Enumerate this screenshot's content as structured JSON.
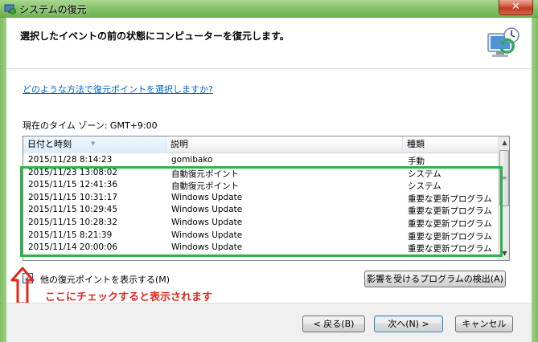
{
  "window": {
    "title": "システムの復元",
    "close_label": "✕"
  },
  "header": {
    "title": "選択したイベントの前の状態にコンピューターを復元します。"
  },
  "help_link": "どのような方法で復元ポイントを選択しますか?",
  "timezone": "現在のタイム ゾーン: GMT+9:00",
  "list": {
    "columns": [
      "日付と時刻",
      "説明",
      "種類"
    ],
    "rows": [
      {
        "date": "2015/11/28 8:14:23",
        "desc": "gomibako",
        "type": "手動"
      },
      {
        "date": "2015/11/23 13:08:02",
        "desc": "自動復元ポイント",
        "type": "システム"
      },
      {
        "date": "2015/11/15 12:41:36",
        "desc": "自動復元ポイント",
        "type": "システム"
      },
      {
        "date": "2015/11/15 10:31:17",
        "desc": "Windows Update",
        "type": "重要な更新プログラム"
      },
      {
        "date": "2015/11/15 10:29:45",
        "desc": "Windows Update",
        "type": "重要な更新プログラム"
      },
      {
        "date": "2015/11/15 10:28:32",
        "desc": "Windows Update",
        "type": "重要な更新プログラム"
      },
      {
        "date": "2015/11/15 8:21:39",
        "desc": "Windows Update",
        "type": "重要な更新プログラム"
      },
      {
        "date": "2015/11/14 20:00:06",
        "desc": "Windows Update",
        "type": "重要な更新プログラム"
      }
    ]
  },
  "checkbox": {
    "label": "他の復元ポイントを表示する(M)",
    "checked": true,
    "mark": "✓"
  },
  "annotation": {
    "text": "ここにチェックすると表示されます",
    "color": "#e0281c",
    "highlight_color": "#2db34a"
  },
  "buttons": {
    "detect": "影響を受けるプログラムの検出(A)",
    "back": "< 戻る(B)",
    "next": "次へ(N) >",
    "cancel": "キャンセル"
  }
}
